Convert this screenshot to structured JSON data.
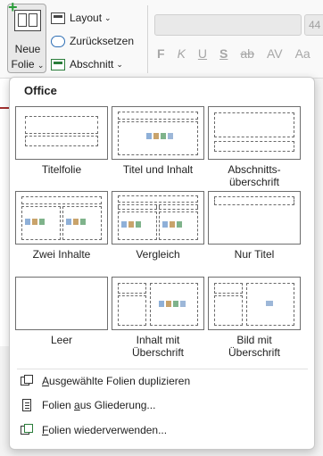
{
  "ribbon": {
    "new_slide": {
      "line1": "Neue",
      "line2": "Folie",
      "chevron": "⌄"
    },
    "layout_label": "Layout",
    "reset_label": "Zurücksetzen",
    "section_label": "Abschnitt",
    "font_size_value": "44",
    "format_buttons": [
      "F",
      "K",
      "U",
      "S",
      "ab",
      "AV",
      "Aa"
    ]
  },
  "menu": {
    "section_title": "Office",
    "layouts": [
      {
        "label": "Titelfolie"
      },
      {
        "label": "Titel und Inhalt"
      },
      {
        "label_line1": "Abschnitts-",
        "label_line2": "überschrift"
      },
      {
        "label": "Zwei Inhalte"
      },
      {
        "label": "Vergleich"
      },
      {
        "label": "Nur Titel"
      },
      {
        "label": "Leer"
      },
      {
        "label_line1": "Inhalt mit",
        "label_line2": "Überschrift"
      },
      {
        "label_line1": "Bild mit",
        "label_line2": "Überschrift"
      }
    ],
    "actions": [
      {
        "pre": "",
        "accel": "A",
        "post": "usgewählte Folien duplizieren"
      },
      {
        "pre": "Folien ",
        "accel": "a",
        "post": "us Gliederung..."
      },
      {
        "pre": "",
        "accel": "F",
        "post": "olien wiederverwenden..."
      }
    ]
  },
  "colors": {
    "accent_green": "#2a9d3a",
    "panel_border": "#c9c9c9",
    "thumb_border": "#6e6e6e"
  }
}
